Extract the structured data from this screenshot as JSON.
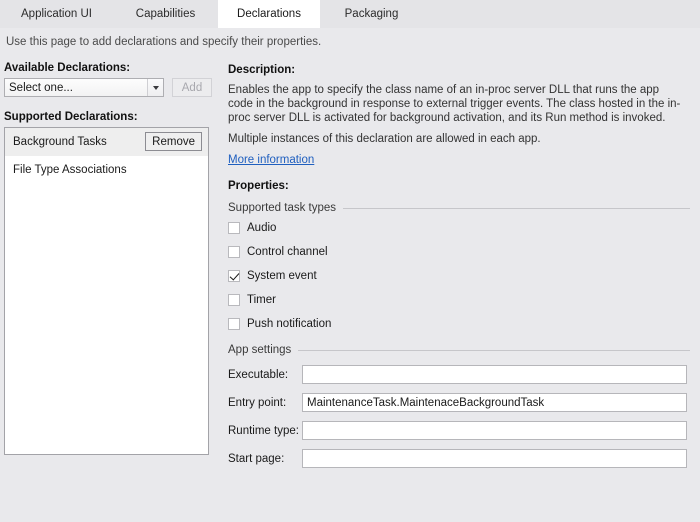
{
  "tabs": [
    {
      "label": "Application UI",
      "selected": false
    },
    {
      "label": "Capabilities",
      "selected": false
    },
    {
      "label": "Declarations",
      "selected": true
    },
    {
      "label": "Packaging",
      "selected": false
    }
  ],
  "page_description": "Use this page to add declarations and specify their properties.",
  "left": {
    "available_label": "Available Declarations:",
    "select_value": "Select one...",
    "add_label": "Add",
    "supported_label": "Supported Declarations:",
    "items": [
      {
        "label": "Background Tasks",
        "selected": true,
        "remove_label": "Remove"
      },
      {
        "label": "File Type Associations",
        "selected": false
      }
    ]
  },
  "right": {
    "description_heading": "Description:",
    "description_paragraphs": [
      "Enables the app to specify the class name of an in-proc server DLL that runs the app code in the background in response to external trigger events. The class hosted in the in-proc server DLL is activated for background activation, and its Run method is invoked.",
      "Multiple instances of this declaration are allowed in each app."
    ],
    "more_information_label": "More information",
    "properties_heading": "Properties:",
    "task_types_group": "Supported task types",
    "task_types": [
      {
        "label": "Audio",
        "checked": false
      },
      {
        "label": "Control channel",
        "checked": false
      },
      {
        "label": "System event",
        "checked": true
      },
      {
        "label": "Timer",
        "checked": false
      },
      {
        "label": "Push notification",
        "checked": false
      }
    ],
    "app_settings_group": "App settings",
    "fields": [
      {
        "label": "Executable:",
        "value": ""
      },
      {
        "label": "Entry point:",
        "value": "MaintenanceTask.MaintenaceBackgroundTask"
      },
      {
        "label": "Runtime type:",
        "value": ""
      },
      {
        "label": "Start page:",
        "value": ""
      }
    ]
  },
  "colors": {
    "background": "#e9e9ec",
    "tabstrip": "#e4e4e7",
    "selected_tab": "#ffffff",
    "link": "#1f5fbf",
    "field_border": "#b6b6ba"
  }
}
